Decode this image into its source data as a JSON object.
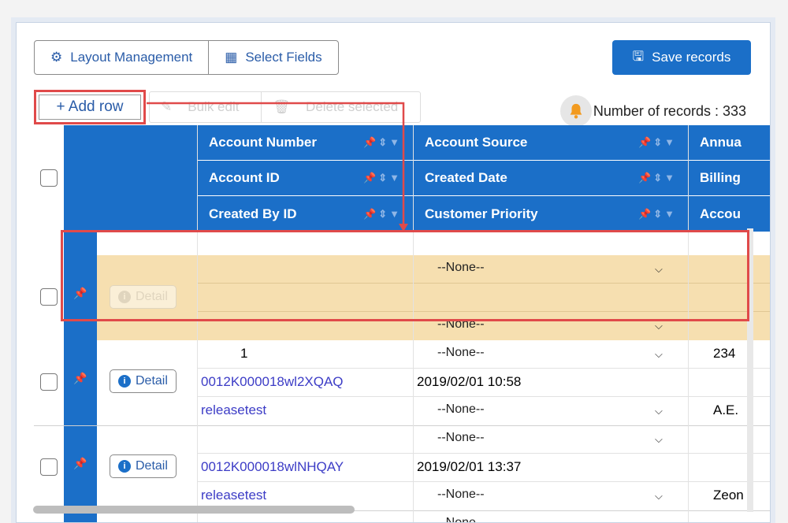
{
  "toolbar": {
    "layout_label": "Layout Management",
    "select_fields_label": "Select Fields",
    "save_label": "Save records",
    "add_row_label": "+ Add row",
    "bulk_edit_label": "Bulk edit",
    "delete_selected_label": "Delete selected",
    "records_label": "Number of records : 333"
  },
  "columns": {
    "col1": [
      "Account Number",
      "Account ID",
      "Created By ID"
    ],
    "col2": [
      "Account Source",
      "Created Date",
      "Customer Priority"
    ],
    "col3": [
      "Annua",
      "Billing",
      "Accou"
    ]
  },
  "new_row": {
    "detail_label": "Detail",
    "select_1": "--None--",
    "select_2": "--None--"
  },
  "rows": [
    {
      "detail_label": "Detail",
      "account_number": "1",
      "account_source": "--None--",
      "col3_top": "234",
      "account_id": "0012K000018wl2XQAQ",
      "created_date": "2019/02/01 10:58",
      "created_by": "releasetest",
      "customer_priority": "--None--",
      "col3_bottom": "A.E."
    },
    {
      "detail_label": "Detail",
      "account_number": "",
      "account_source": "--None--",
      "col3_top": "",
      "account_id": "0012K000018wlNHQAY",
      "created_date": "2019/02/01 13:37",
      "created_by": "releasetest",
      "customer_priority": "--None--",
      "col3_bottom": "Zeon"
    }
  ],
  "partial_row": {
    "account_source": "--None--"
  },
  "colors": {
    "accent": "#1b6fc8",
    "highlight": "#e04a4a",
    "new_row_bg": "#f6dfb0",
    "link": "#3c3cc6"
  }
}
